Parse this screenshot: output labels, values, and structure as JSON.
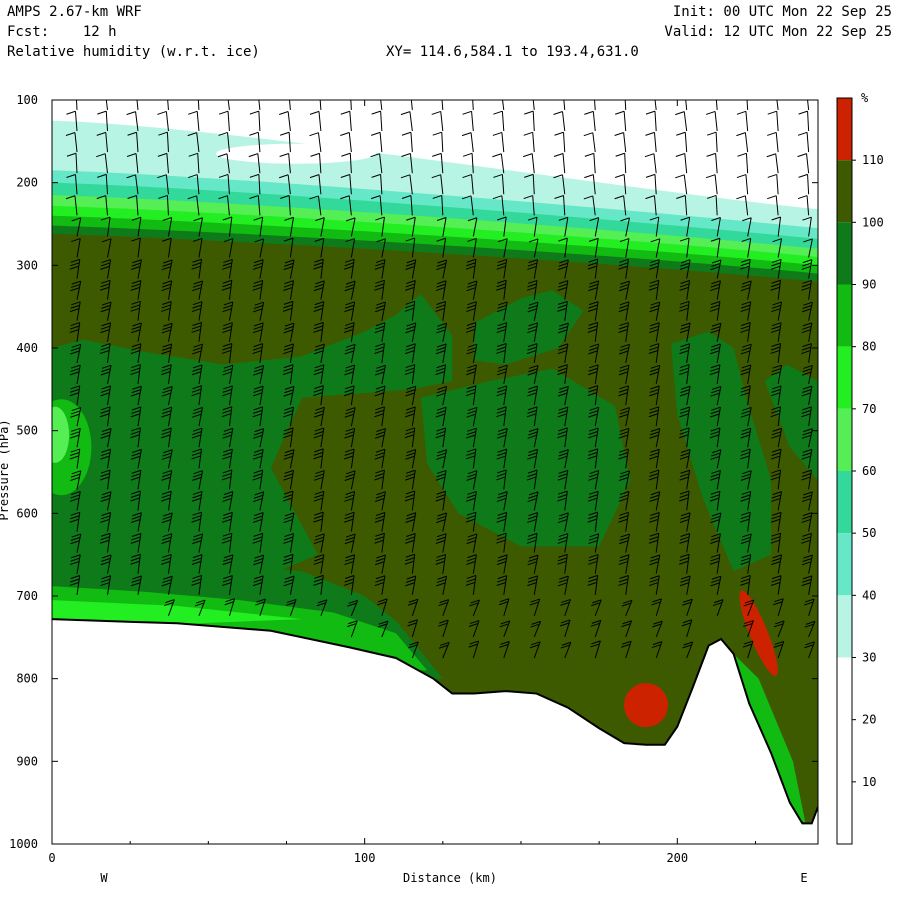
{
  "header": {
    "model": "AMPS 2.67-km WRF",
    "fcst": "Fcst:    12 h",
    "field": "Relative humidity (w.r.t. ice)",
    "xy": "XY= 114.6,584.1 to 193.4,631.0",
    "init": "Init: 00 UTC Mon 22 Sep 25",
    "valid": "Valid: 12 UTC Mon 22 Sep 25"
  },
  "colors": {
    "c0": "#ffffff",
    "c30": "#b8f4e4",
    "c40": "#66e8c8",
    "c50": "#33d99a",
    "c60": "#55ee55",
    "c70": "#22ee22",
    "c80": "#11bb11",
    "c90": "#0f7a1a",
    "c100": "#3d5a00",
    "c110": "#cc2200",
    "terrain": "#ffffff",
    "barb": "#000000"
  },
  "chart_data": {
    "type": "heatmap",
    "title": "Relative humidity (w.r.t. ice)",
    "xlabel": "Distance (km)",
    "ylabel": "Pressure (hPa)",
    "xlim": [
      0,
      245
    ],
    "ylim": [
      1000,
      100
    ],
    "x_ticks": [
      0,
      100,
      200
    ],
    "y_ticks": [
      100,
      200,
      300,
      400,
      500,
      600,
      700,
      800,
      900,
      1000
    ],
    "left_end_label": "W",
    "right_end_label": "E",
    "colorbar": {
      "unit": "%",
      "levels": [
        10,
        20,
        30,
        40,
        50,
        60,
        70,
        80,
        90,
        100,
        110
      ]
    },
    "terrain_surface_hpa": [
      [
        0,
        728
      ],
      [
        15,
        730
      ],
      [
        40,
        733
      ],
      [
        70,
        742
      ],
      [
        95,
        762
      ],
      [
        110,
        775
      ],
      [
        122,
        800
      ],
      [
        128,
        818
      ],
      [
        135,
        818
      ],
      [
        145,
        815
      ],
      [
        155,
        818
      ],
      [
        165,
        835
      ],
      [
        175,
        860
      ],
      [
        183,
        878
      ],
      [
        190,
        880
      ],
      [
        196,
        880
      ],
      [
        200,
        858
      ],
      [
        205,
        810
      ],
      [
        210,
        760
      ],
      [
        214,
        752
      ],
      [
        218,
        770
      ],
      [
        223,
        830
      ],
      [
        230,
        890
      ],
      [
        236,
        950
      ],
      [
        240,
        975
      ],
      [
        243,
        975
      ],
      [
        245,
        955
      ]
    ]
  }
}
